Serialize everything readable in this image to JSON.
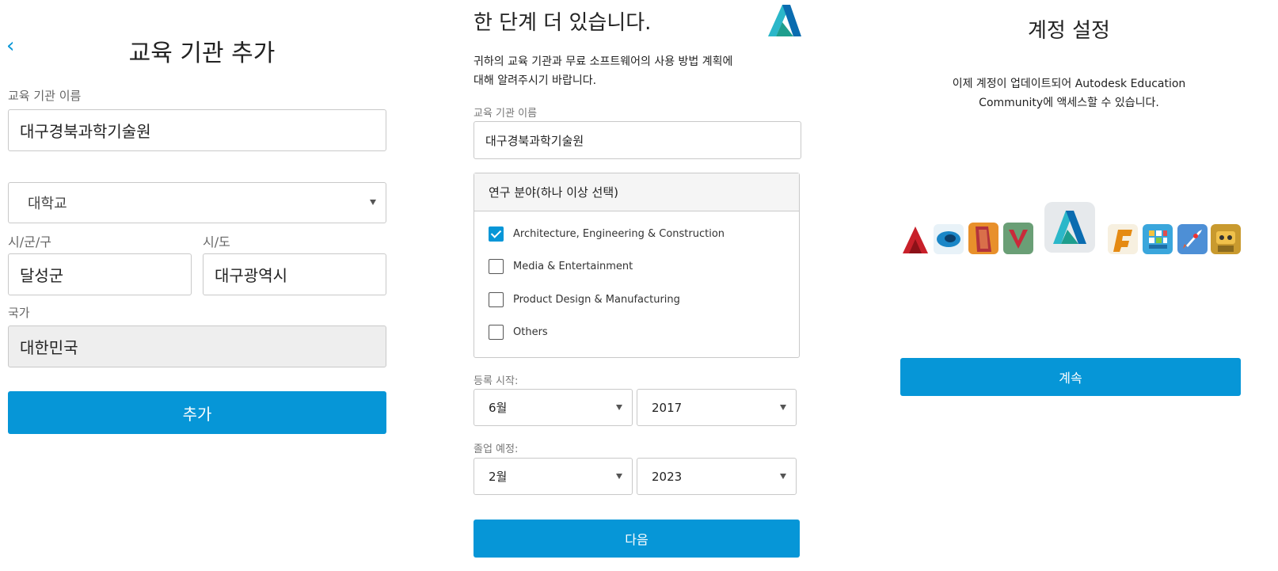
{
  "panel1": {
    "title": "교육 기관 추가",
    "institution_label": "교육 기관 이름",
    "institution_value": "대구경북과학기술원",
    "type_value": "대학교",
    "city_label": "시/군/구",
    "city_value": "달성군",
    "province_label": "시/도",
    "province_value": "대구광역시",
    "country_label": "국가",
    "country_value": "대한민국",
    "add_button": "추가"
  },
  "panel2": {
    "title": "한 단계 더 있습니다.",
    "desc_line1": "귀하의 교육 기관과 무료 소프트웨어의 사용 방법 계획에",
    "desc_line2": "대해 알려주시기 바랍니다.",
    "institution_label": "교육 기관 이름",
    "institution_value": "대구경북과학기술원",
    "study_header": "연구 분야(하나 이상 선택)",
    "study_options": [
      {
        "label": "Architecture, Engineering & Construction",
        "checked": true
      },
      {
        "label": "Media & Entertainment",
        "checked": false
      },
      {
        "label": "Product Design & Manufacturing",
        "checked": false
      },
      {
        "label": "Others",
        "checked": false
      }
    ],
    "enroll_label": "등록 시작:",
    "enroll_month": "6월",
    "enroll_year": "2017",
    "grad_label": "졸업 예정:",
    "grad_month": "2월",
    "grad_year": "2023",
    "next_button": "다음"
  },
  "panel3": {
    "title": "계정 설정",
    "desc_line1": "이제 계정이 업데이트되어 Autodesk Education",
    "desc_line2": "Community에 액세스할 수 있습니다.",
    "continue_button": "계속"
  },
  "colors": {
    "accent": "#0696d7",
    "border": "#c9c9c9",
    "disabled_bg": "#eeeeee"
  }
}
